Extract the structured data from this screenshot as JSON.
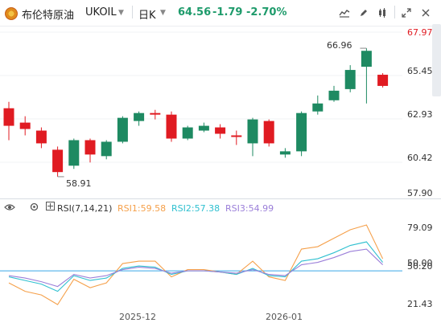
{
  "header": {
    "name": "布伦特原油",
    "symbol": "UKOIL",
    "period": "日K",
    "price": "64.56",
    "change": "-1.79",
    "change_pct": "-2.70%",
    "accent_down": "#1e9b6b"
  },
  "toolbar": {
    "icons": [
      "line-chart-icon",
      "draw-icon",
      "indicator-icon",
      "expand-icon",
      "close-icon"
    ]
  },
  "price_axis": {
    "ticks": [
      "67.97",
      "65.45",
      "62.93",
      "60.42",
      "57.90"
    ]
  },
  "rsi_panel": {
    "label": "RSI(7,14,21)",
    "rsi1": "RSI1:59.58",
    "rsi2": "RSI2:57.38",
    "rsi3": "RSI3:54.99",
    "axis_ticks": [
      "79.09",
      "50.20",
      "50.00",
      "21.43"
    ],
    "colors": {
      "rsi1": "#f5a04a",
      "rsi2": "#2fc0d0",
      "rsi3": "#9b7fd9",
      "baseline": "#39a6e6"
    }
  },
  "x_axis": {
    "dates": [
      "2025-12",
      "2026-01"
    ]
  },
  "annotations": {
    "high": "66.96",
    "low": "58.91"
  },
  "chart_data": [
    {
      "type": "candlestick",
      "series": [
        {
          "o": 63.2,
          "h": 63.6,
          "l": 61.2,
          "c": 62.1,
          "dir": "down"
        },
        {
          "o": 62.3,
          "h": 62.7,
          "l": 61.5,
          "c": 61.9,
          "dir": "down"
        },
        {
          "o": 61.8,
          "h": 62.0,
          "l": 60.7,
          "c": 61.0,
          "dir": "down"
        },
        {
          "o": 60.6,
          "h": 60.8,
          "l": 58.91,
          "c": 59.2,
          "dir": "down"
        },
        {
          "o": 59.6,
          "h": 61.3,
          "l": 59.4,
          "c": 61.2,
          "dir": "up"
        },
        {
          "o": 61.2,
          "h": 61.3,
          "l": 59.8,
          "c": 60.3,
          "dir": "down"
        },
        {
          "o": 60.2,
          "h": 61.2,
          "l": 60.0,
          "c": 61.1,
          "dir": "up"
        },
        {
          "o": 61.1,
          "h": 62.7,
          "l": 61.0,
          "c": 62.6,
          "dir": "up"
        },
        {
          "o": 62.4,
          "h": 63.0,
          "l": 62.1,
          "c": 62.9,
          "dir": "up"
        },
        {
          "o": 62.9,
          "h": 63.1,
          "l": 62.5,
          "c": 62.8,
          "dir": "down"
        },
        {
          "o": 62.8,
          "h": 63.0,
          "l": 61.1,
          "c": 61.3,
          "dir": "down"
        },
        {
          "o": 61.3,
          "h": 62.1,
          "l": 61.2,
          "c": 62.0,
          "dir": "up"
        },
        {
          "o": 61.8,
          "h": 62.3,
          "l": 61.7,
          "c": 62.1,
          "dir": "up"
        },
        {
          "o": 62.0,
          "h": 62.2,
          "l": 61.3,
          "c": 61.6,
          "dir": "down"
        },
        {
          "o": 61.5,
          "h": 61.8,
          "l": 60.9,
          "c": 61.4,
          "dir": "down"
        },
        {
          "o": 61.0,
          "h": 62.6,
          "l": 60.2,
          "c": 62.5,
          "dir": "up"
        },
        {
          "o": 62.4,
          "h": 62.5,
          "l": 60.8,
          "c": 61.0,
          "dir": "down"
        },
        {
          "o": 60.3,
          "h": 60.7,
          "l": 60.1,
          "c": 60.5,
          "dir": "up"
        },
        {
          "o": 60.5,
          "h": 63.0,
          "l": 60.2,
          "c": 62.9,
          "dir": "up"
        },
        {
          "o": 63.0,
          "h": 64.0,
          "l": 62.8,
          "c": 63.5,
          "dir": "up"
        },
        {
          "o": 63.7,
          "h": 64.6,
          "l": 63.6,
          "c": 64.3,
          "dir": "up"
        },
        {
          "o": 64.4,
          "h": 65.9,
          "l": 64.2,
          "c": 65.6,
          "dir": "up"
        },
        {
          "o": 65.8,
          "h": 66.96,
          "l": 63.5,
          "c": 66.8,
          "dir": "up"
        },
        {
          "o": 65.3,
          "h": 65.4,
          "l": 64.5,
          "c": 64.6,
          "dir": "down"
        }
      ],
      "ylim": [
        57.9,
        67.97
      ],
      "colors": {
        "up": "#1e8a62",
        "down": "#e01b22"
      }
    },
    {
      "type": "line",
      "series": [
        {
          "name": "RSI1",
          "color": "#f5a04a",
          "values": [
            40,
            33,
            30,
            22,
            43,
            36,
            40,
            56,
            58,
            58,
            45,
            51,
            51,
            49,
            47,
            58,
            45,
            42,
            68,
            70,
            77,
            84,
            88,
            60
          ]
        },
        {
          "name": "RSI2",
          "color": "#2fc0d0",
          "values": [
            45,
            42,
            39,
            33,
            46,
            42,
            44,
            52,
            54,
            53,
            47,
            50,
            50,
            49,
            47,
            52,
            46,
            45,
            58,
            60,
            65,
            71,
            74,
            57
          ]
        },
        {
          "name": "RSI3",
          "color": "#9b7fd9",
          "values": [
            46,
            44,
            41,
            37,
            47,
            44,
            46,
            51,
            53,
            52,
            48,
            50,
            50,
            49,
            48,
            51,
            47,
            46,
            55,
            57,
            61,
            66,
            68,
            55
          ]
        }
      ],
      "ylim": [
        21.43,
        92
      ]
    }
  ]
}
